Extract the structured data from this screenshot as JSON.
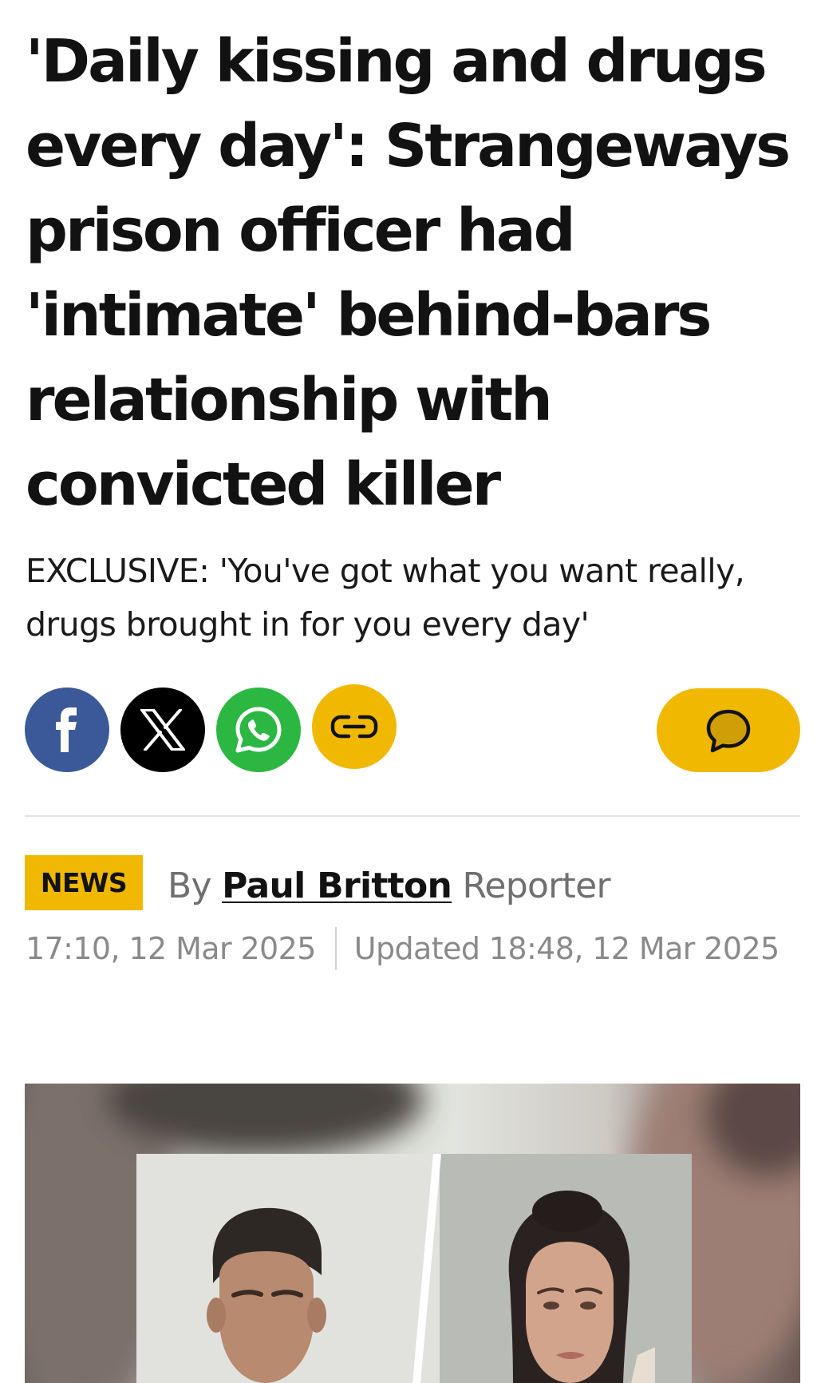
{
  "article": {
    "headline": "'Daily kissing and drugs every day': Strangeways prison officer had 'intimate' behind-bars relationship with convicted killer",
    "standfirst": "EXCLUSIVE: 'You've got what you want really, drugs brought in for you every day'",
    "section": "NEWS",
    "byline": {
      "prefix": "By",
      "author": "Paul Britton",
      "role": "Reporter"
    },
    "published": "17:10, 12 Mar 2025",
    "updated": "Updated 18:48, 12 Mar 2025"
  },
  "share": {
    "buttons": [
      {
        "icon": "facebook-icon",
        "color": "#3b5998"
      },
      {
        "icon": "x-icon",
        "color": "#000000"
      },
      {
        "icon": "whatsapp-icon",
        "color": "#2cb742"
      },
      {
        "icon": "link-icon",
        "color": "#f0b800"
      }
    ],
    "comments_icon": "comment-bubble-icon",
    "comments_color": "#f0b800"
  },
  "theme": {
    "accent": "#f0b800",
    "text": "#121212",
    "muted": "#6f6f6f"
  }
}
